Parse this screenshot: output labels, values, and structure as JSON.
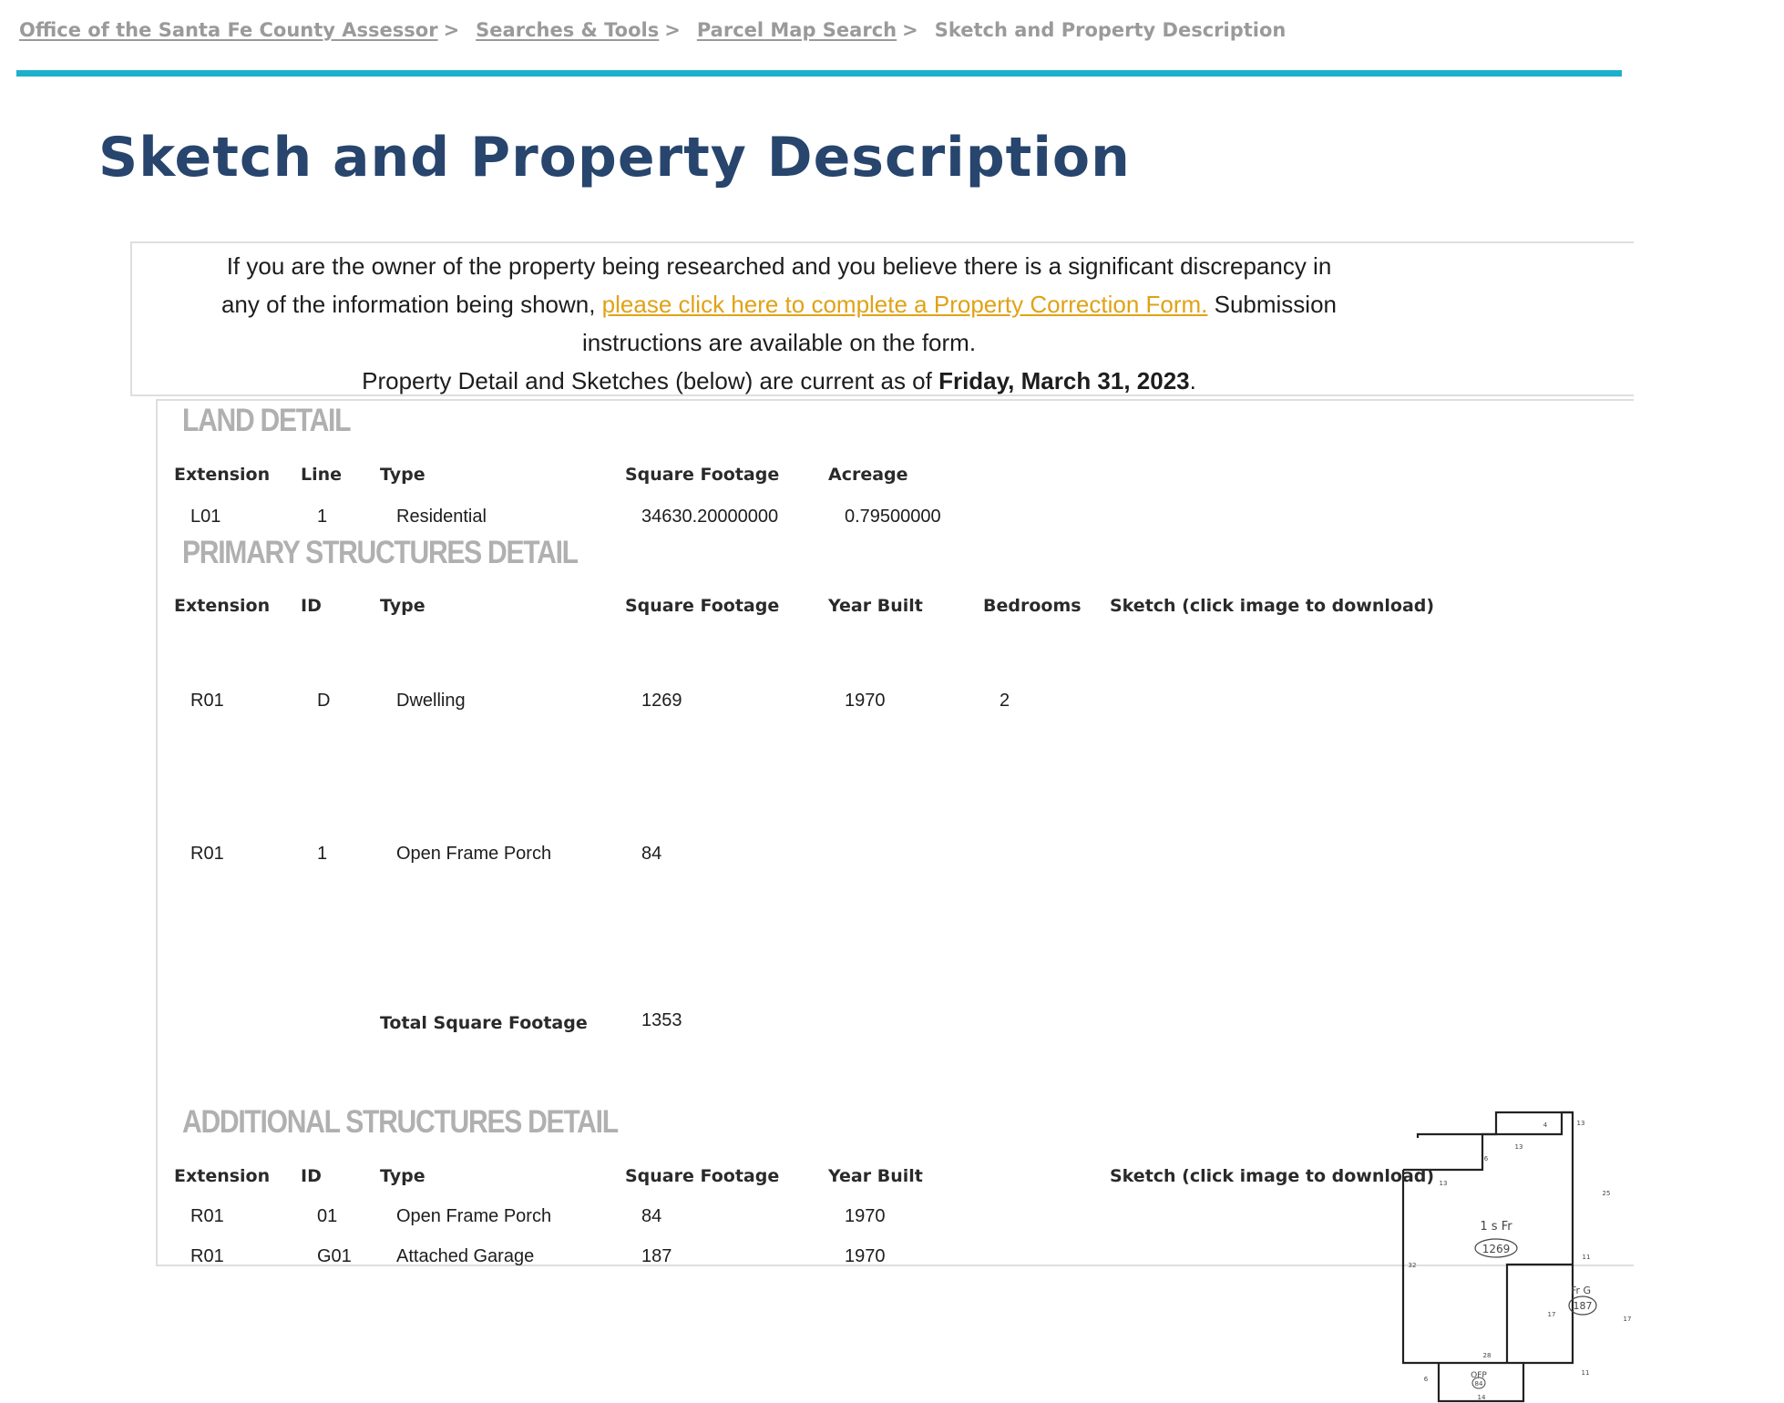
{
  "breadcrumb": {
    "items": [
      "Office of the Santa Fe County Assessor",
      "Searches & Tools",
      "Parcel Map Search"
    ],
    "separator": ">",
    "current": "Sketch and Property Description"
  },
  "page": {
    "title": "Sketch and Property Description"
  },
  "notice": {
    "line1": "If you are the owner of the property being researched and you believe there is a significant discrepancy in",
    "line2_before": "any of the information being shown, ",
    "link_text": "please click here to complete a Property Correction Form.",
    "line2_after": " Submission",
    "line3": "instructions are available on the form.",
    "line4_before": "Property Detail and Sketches (below) are current as of ",
    "date": "Friday, March 31, 2023",
    "line4_after": "."
  },
  "land_detail": {
    "title": "LAND DETAIL",
    "headers": [
      "Extension",
      "Line",
      "Type",
      "Square Footage",
      "Acreage"
    ],
    "rows": [
      [
        "L01",
        "1",
        "Residential",
        "34630.20000000",
        "0.79500000"
      ]
    ]
  },
  "primary_structures": {
    "title": "PRIMARY STRUCTURES DETAIL",
    "headers": [
      "Extension",
      "ID",
      "Type",
      "Square Footage",
      "Year Built",
      "Bedrooms",
      "Sketch (click image to download)"
    ],
    "rows": [
      [
        "R01",
        "D",
        "Dwelling",
        "1269",
        "1970",
        "2"
      ],
      [
        "R01",
        "1",
        "Open Frame Porch",
        "84",
        "",
        ""
      ]
    ],
    "total_label": "Total Square Footage",
    "total_value": "1353"
  },
  "additional_structures": {
    "title": "ADDITIONAL STRUCTURES DETAIL",
    "headers": [
      "Extension",
      "ID",
      "Type",
      "Square Footage",
      "Year Built",
      "Sketch (click image to download)"
    ],
    "rows": [
      [
        "R01",
        "01",
        "Open Frame Porch",
        "84",
        "1970"
      ],
      [
        "R01",
        "G01",
        "Attached Garage",
        "187",
        "1970"
      ]
    ]
  },
  "sketch": {
    "main_label": "1 s Fr",
    "main_area": "1269",
    "garage_label": "Fr G",
    "garage_area": "187",
    "porch_label": "OFP",
    "porch_area": "84",
    "dims": [
      "4",
      "13",
      "6",
      "13",
      "13",
      "25",
      "11",
      "32",
      "17",
      "17",
      "28",
      "11",
      "6",
      "14"
    ]
  }
}
